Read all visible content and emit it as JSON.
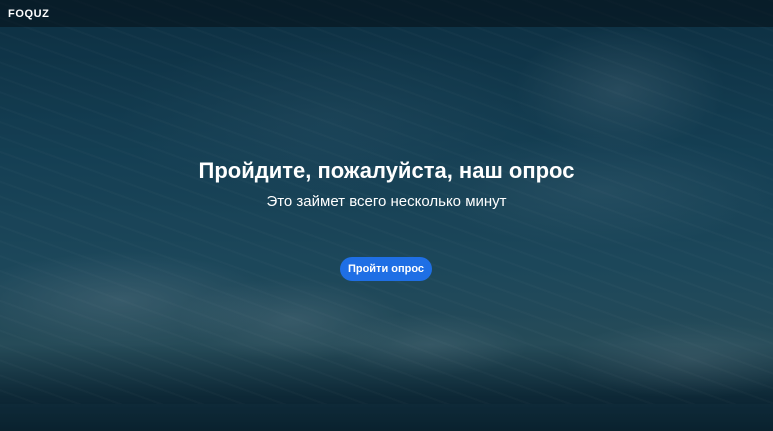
{
  "header": {
    "logo": "FOQUZ"
  },
  "hero": {
    "title": "Пройдите, пожалуйста, наш опрос",
    "subtitle": "Это займет всего несколько минут",
    "button_label": "Пройти опрос"
  },
  "colors": {
    "accent": "#1f6fe5",
    "topbar": "#050e16",
    "text": "#ffffff"
  }
}
